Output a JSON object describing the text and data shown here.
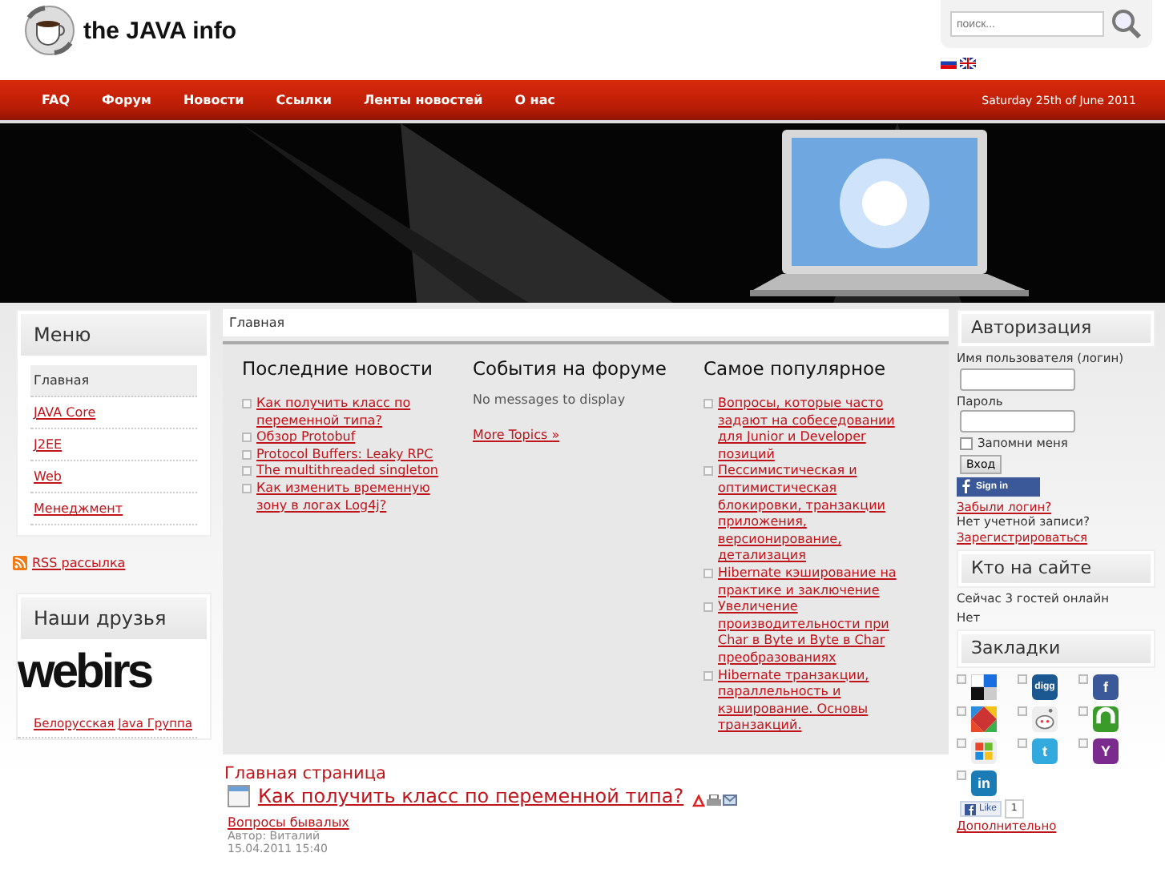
{
  "logo": {
    "title": "the JAVA info"
  },
  "search": {
    "placeholder": "поиск..."
  },
  "nav": {
    "items": [
      "FAQ",
      "Форум",
      "Новости",
      "Ссылки",
      "Ленты новостей",
      "О нас"
    ],
    "date": "Saturday 25th of June 2011"
  },
  "menu": {
    "title": "Меню",
    "items": [
      {
        "label": "Главная",
        "selected": true
      },
      {
        "label": "JAVA Core",
        "selected": false
      },
      {
        "label": "J2EE",
        "selected": false
      },
      {
        "label": "Web",
        "selected": false
      },
      {
        "label": "Менеджмент",
        "selected": false
      }
    ]
  },
  "rss": "RSS рассылка",
  "friends": {
    "title": "Наши друзья",
    "logo": "webirs",
    "link": "Белорусская Java Группа"
  },
  "breadcrumb": "Главная",
  "columns": [
    {
      "title": "Последние новости",
      "links": [
        "Как получить класс по переменной типа?",
        "Обзор Protobuf",
        "Protocol Buffers: Leaky RPC",
        "The multithreaded singleton",
        "Как изменить временную зону в логах Log4j?"
      ]
    },
    {
      "title": "События на форуме",
      "note": "No messages to display",
      "more": "More Topics »"
    },
    {
      "title": "Самое популярное",
      "links": [
        "Вопросы, которые часто задают на собеседовании для Junior и Developer позиций",
        "Пессимистическая и оптимистическая блокировки, транзакции приложения, версионирование, детализация",
        "Hibernate кэширование на практике и заключение",
        "Увеличение производительности при Char в Byte и Byte в Char преобразованиях",
        "Hibernate транзакции, параллельность и кэширование. Основы транзакций."
      ]
    }
  ],
  "article": {
    "section": "Главная страница",
    "title": "Как получить класс по переменной типа?",
    "category": "Вопросы бывалых",
    "author": "Автор: Виталий",
    "date": "15.04.2011 15:40"
  },
  "login": {
    "title": "Авторизация",
    "user_label": "Имя пользователя (логин)",
    "password_label": "Пароль",
    "remember": "Запомни меня",
    "remember_checked": false,
    "submit": "Вход",
    "fb_button": "Sign in",
    "forgot": "Забыли логин?",
    "no_account": "Нет учетной записи?",
    "register": "Зарегистрироваться"
  },
  "online": {
    "title": "Кто на сайте",
    "text": "Сейчас 3 гостей онлайн",
    "members": "Нет"
  },
  "bookmarks": {
    "title": "Закладки",
    "items": [
      {
        "kind": "delicious"
      },
      {
        "kind": "digg",
        "glyph": "digg"
      },
      {
        "kind": "facebook",
        "glyph": "f"
      },
      {
        "kind": "google"
      },
      {
        "kind": "reddit"
      },
      {
        "kind": "stumbleupon"
      },
      {
        "kind": "windows"
      },
      {
        "kind": "twitter",
        "glyph": "t"
      },
      {
        "kind": "yahoo",
        "glyph": "Y"
      },
      {
        "kind": "linkedin",
        "glyph": "in"
      }
    ],
    "like": "Like",
    "like_count": "1",
    "more": "Дополнительно"
  }
}
